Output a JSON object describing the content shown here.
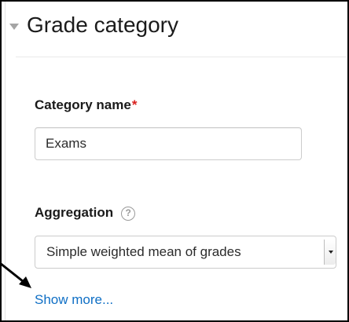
{
  "section": {
    "title": "Grade category",
    "icon": "collapse-triangle-icon"
  },
  "category_name": {
    "label": "Category name",
    "required_marker": "*",
    "value": "Exams"
  },
  "aggregation": {
    "label": "Aggregation",
    "help_icon": "question-mark-icon",
    "help_glyph": "?",
    "selected": "Simple weighted mean of grades"
  },
  "show_more": {
    "label": "Show more..."
  },
  "colors": {
    "link": "#0f6fc5",
    "required": "#d9201e",
    "annotation_arrow": "#000000"
  }
}
